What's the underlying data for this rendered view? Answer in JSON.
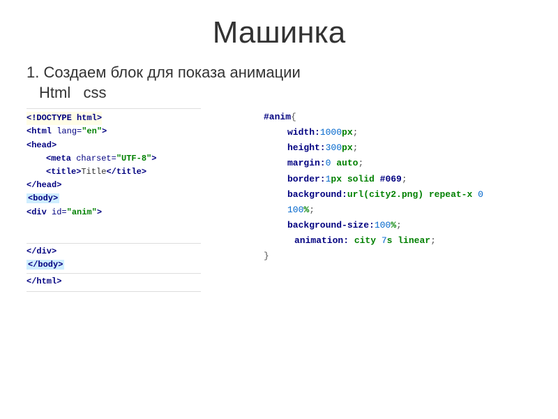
{
  "title": "Машинка",
  "body": {
    "line1": "1. Создаем блок для показа анимации",
    "line2": "Html   css"
  },
  "html_code": {
    "doctype_open": "<!DOCTYPE ",
    "doctype_kw": "html",
    "doctype_close": ">",
    "html_open1": "<html ",
    "lang_attr": "lang=",
    "lang_val": "\"en\"",
    "html_open2": ">",
    "head_open": "<head>",
    "meta1": "<meta ",
    "charset_attr": "charset=",
    "charset_val": "\"UTF-8\"",
    "meta2": ">",
    "title_open": "<title>",
    "title_text": "Title",
    "title_close": "</title>",
    "head_close": "</head>",
    "body_open": "<body>",
    "div1": "<div ",
    "id_attr": "id=",
    "id_val": "\"anim\"",
    "div2": ">",
    "div_close": "</div>",
    "body_close": "</body>",
    "html_close": "</html>"
  },
  "css_code": {
    "selector": "#anim",
    "brace_open": "{",
    "p1_prop": "width:",
    "p1_num": "1000",
    "p1_unit": "px",
    "semi": ";",
    "p2_prop": "height:",
    "p2_num": "300",
    "p2_unit": "px",
    "p3_prop": "margin:",
    "p3_num": "0",
    "p3_val": " auto",
    "p4_prop": "border:",
    "p4_num": "1",
    "p4_unit": "px",
    "p4_val": " solid ",
    "p4_color": "#069",
    "p5_prop": "background:",
    "p5_fn": "url(",
    "p5_arg": "city2.png",
    "p5_fn2": ")",
    "p5_rest": " repeat-x ",
    "p5_n1": "0",
    "p5_sp": " ",
    "p5_n2": "100",
    "p5_pct": "%",
    "p6_prop": "background-size:",
    "p6_num": "100",
    "p6_pct": "%",
    "p7_prop": "animation:",
    "p7_name": " city ",
    "p7_num": "7",
    "p7_unit": "s",
    "p7_val": " linear",
    "brace_close": "}"
  }
}
